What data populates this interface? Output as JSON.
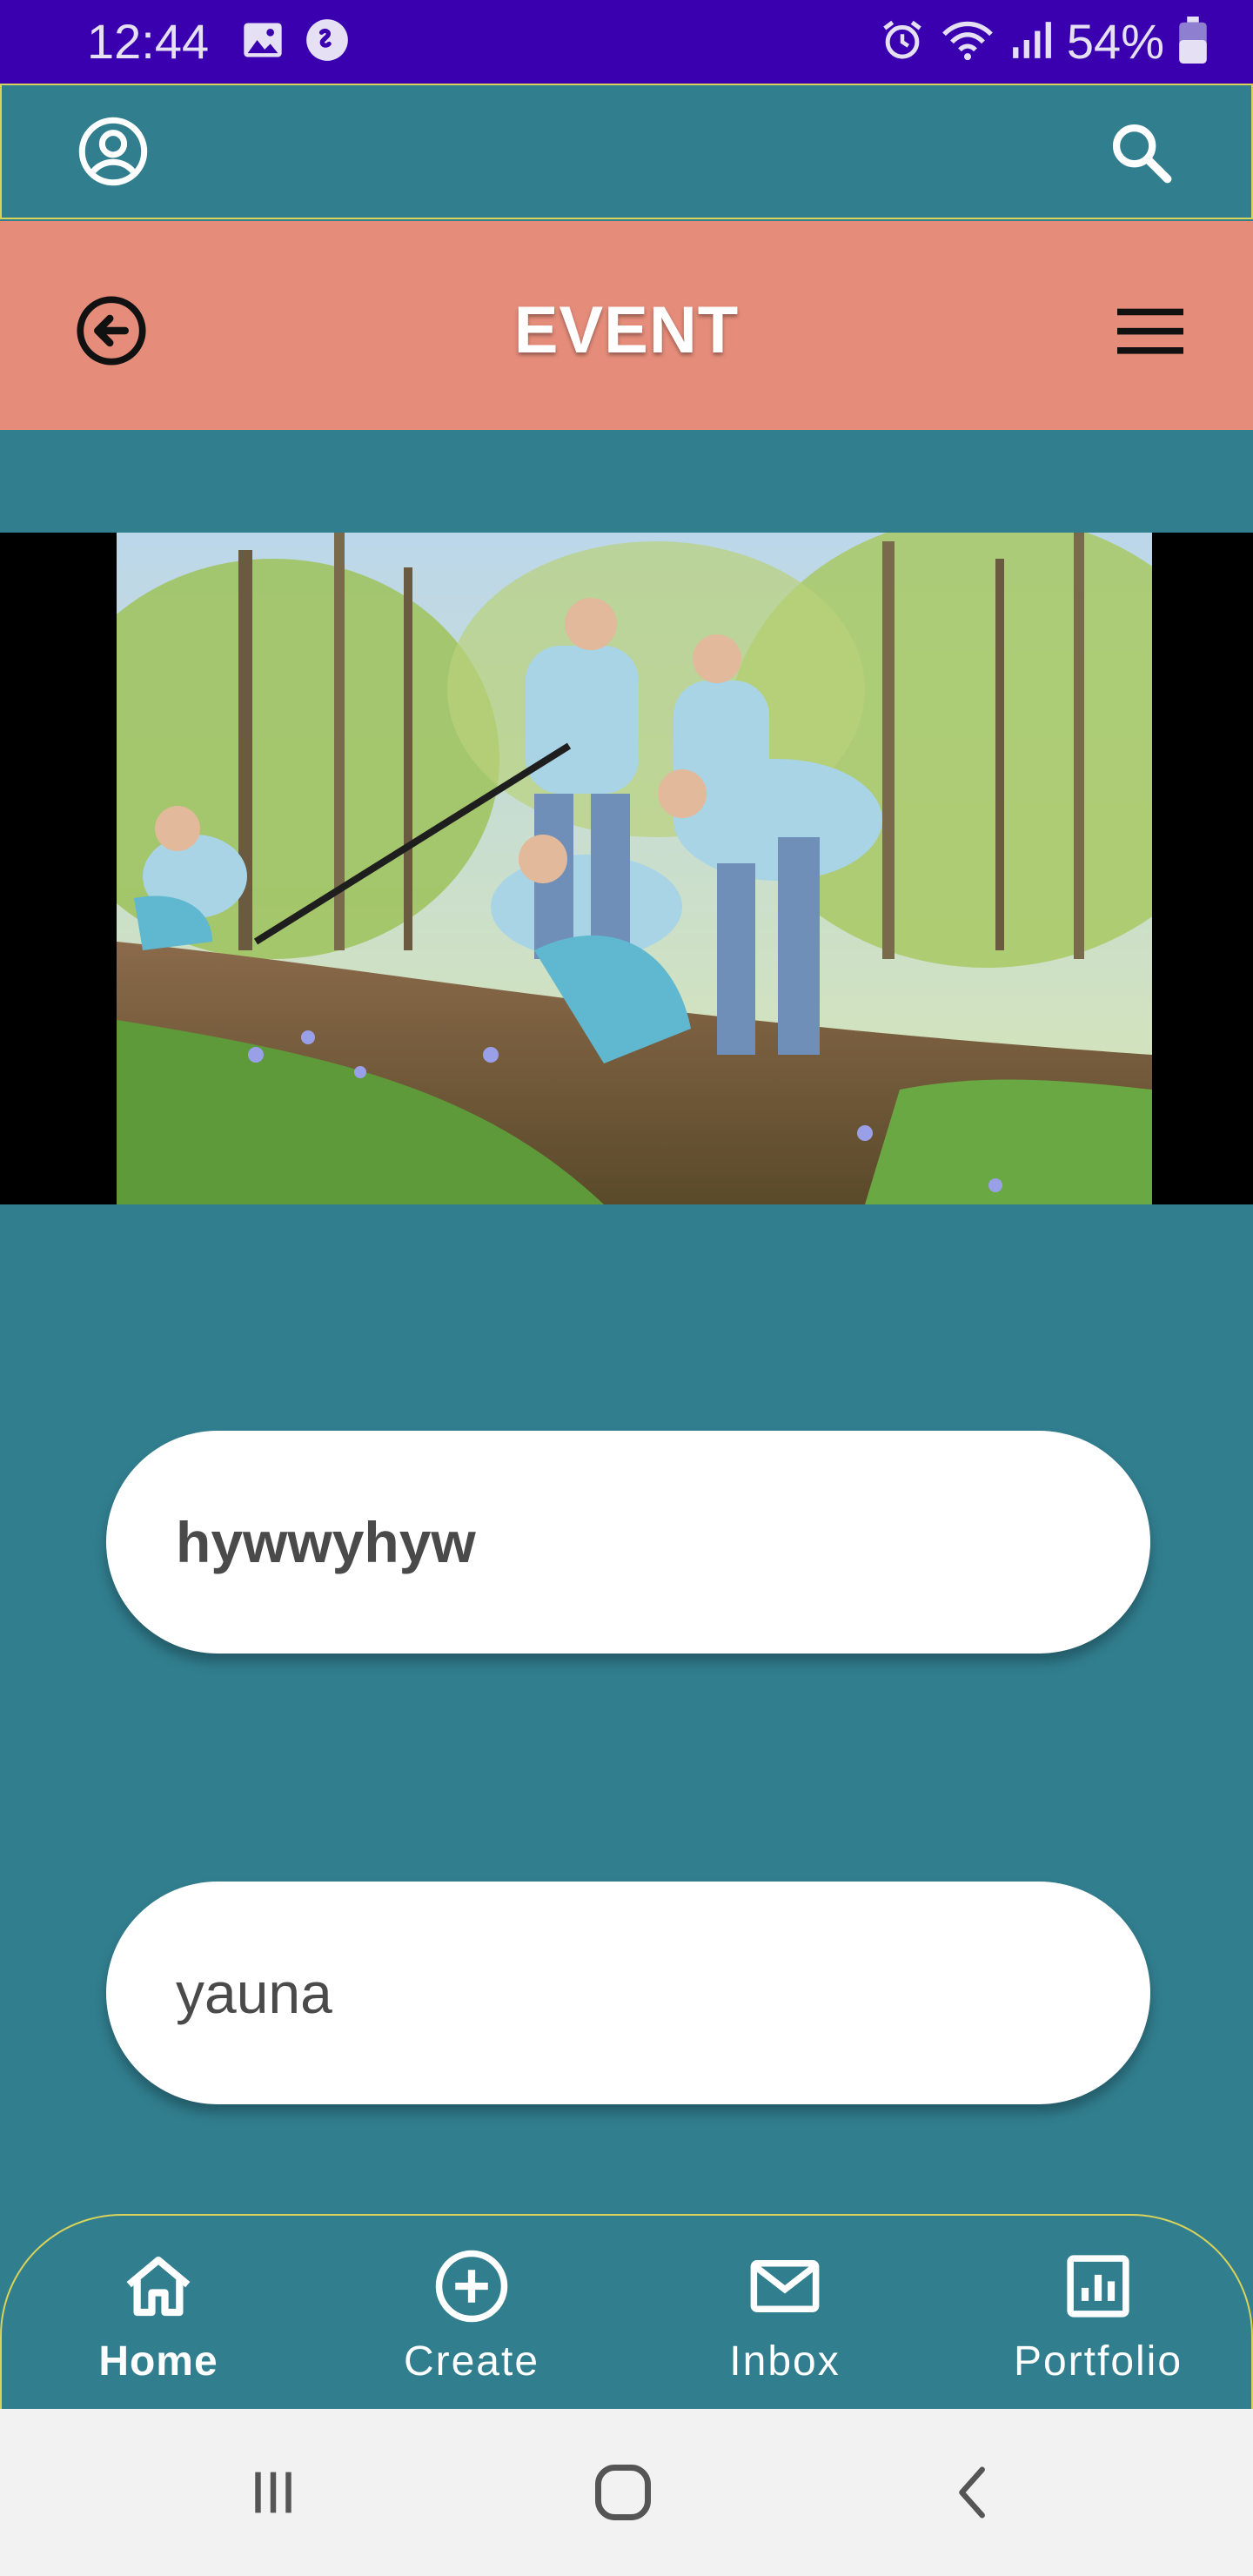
{
  "status_bar": {
    "time": "12:44",
    "battery_percent": "54%"
  },
  "event_header": {
    "title": "EVENT"
  },
  "event": {
    "title": "hywwyhyw",
    "subtitle": "yauna"
  },
  "bottom_nav": {
    "items": [
      {
        "label": "Home",
        "icon": "home-icon",
        "active": true
      },
      {
        "label": "Create",
        "icon": "plus-circle-icon",
        "active": false
      },
      {
        "label": "Inbox",
        "icon": "envelope-icon",
        "active": false
      },
      {
        "label": "Portfolio",
        "icon": "chart-icon",
        "active": false
      }
    ]
  },
  "colors": {
    "status_bar": "#3a00b0",
    "teal": "#317e8f",
    "salmon": "#e58c7a",
    "outline": "#d9d35a"
  }
}
